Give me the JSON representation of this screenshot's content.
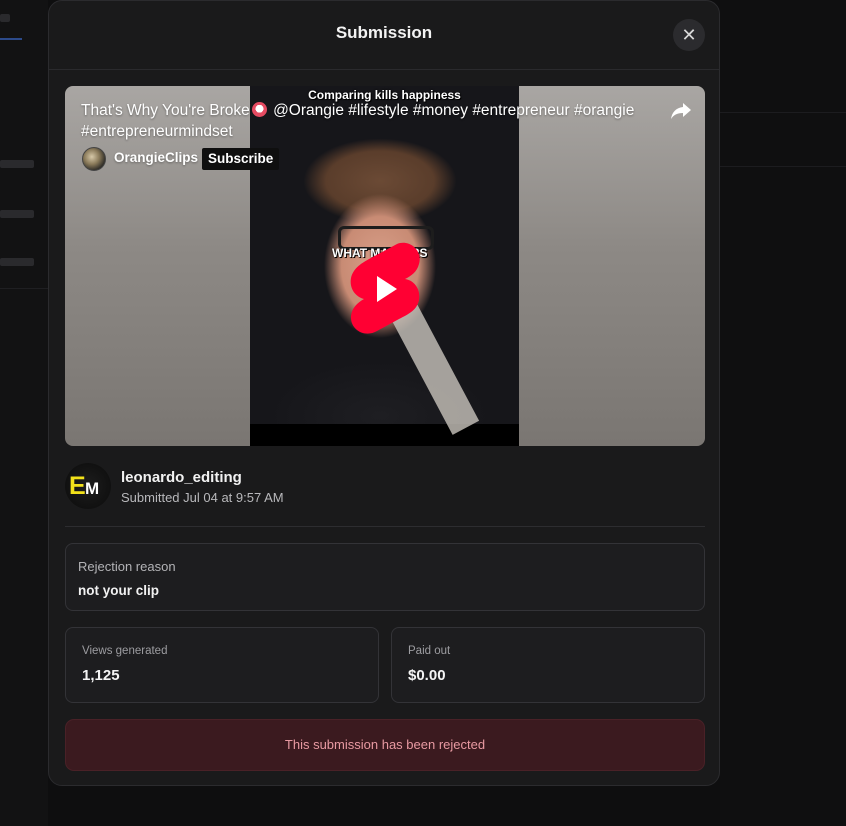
{
  "modal": {
    "title": "Submission",
    "close_glyph": "✕"
  },
  "video": {
    "title_part1": "That's Why You're Broke",
    "title_part2": " @Orangie #lifestyle #money #entrepreneur #orangie #entrepreneurmindset",
    "channel_name": "OrangieClips",
    "subscribe_label": "Subscribe",
    "caption_top": "Comparing kills happiness",
    "caption_mid": "WHAT MATTERS",
    "icons": {
      "share": "share-icon",
      "play": "youtube-shorts-play-icon",
      "emoji": "clown-face-emoji"
    }
  },
  "submitter": {
    "username": "leonardo_editing",
    "submitted": "Submitted Jul 04 at 9:57 AM",
    "avatar_letters": {
      "e": "E",
      "m": "M"
    }
  },
  "rejection": {
    "label": "Rejection reason",
    "value": "not your clip"
  },
  "stats": {
    "views": {
      "label": "Views generated",
      "value": "1,125"
    },
    "paid": {
      "label": "Paid out",
      "value": "$0.00"
    }
  },
  "status": {
    "text": "This submission has been rejected",
    "color": "#e89aa2",
    "background": "#3b1a1f"
  },
  "colors": {
    "modal_bg": "#1a1a1b",
    "youtube_red": "#ff0033",
    "avatar_yellow": "#f2e11a"
  }
}
